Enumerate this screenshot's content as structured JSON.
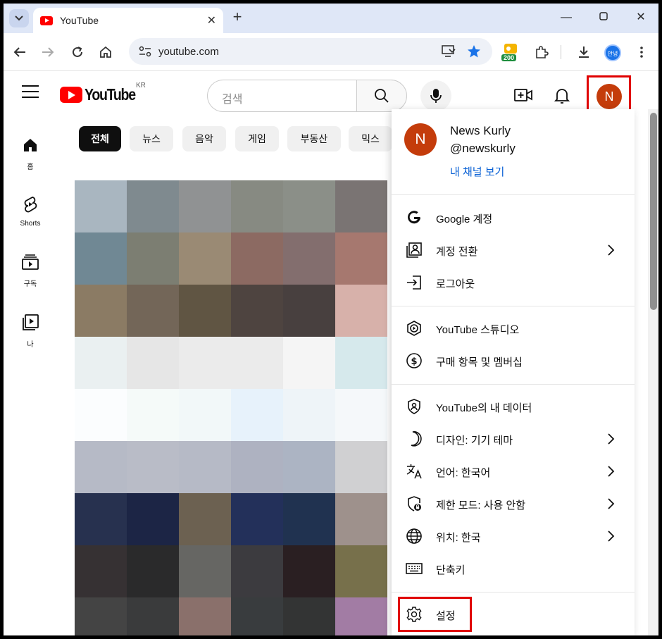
{
  "browser": {
    "tab_title": "YouTube",
    "tab_close": "✕",
    "new_tab": "+",
    "url": "youtube.com",
    "extension_badge": "200",
    "profile_chip_label": "안녕",
    "window_controls": {
      "minimize": "—",
      "maximize": "☐",
      "close": "✕"
    }
  },
  "masthead": {
    "logo_text": "YouTube",
    "region": "KR",
    "search_placeholder": "검색"
  },
  "user": {
    "avatar_letter": "N"
  },
  "guide": [
    {
      "label": "홈",
      "icon": "home-icon"
    },
    {
      "label": "Shorts",
      "icon": "shorts-icon"
    },
    {
      "label": "구독",
      "icon": "subscriptions-icon"
    },
    {
      "label": "나",
      "icon": "you-icon"
    }
  ],
  "chips": [
    "전체",
    "뉴스",
    "음악",
    "게임",
    "부동산",
    "믹스"
  ],
  "account_menu": {
    "name": "News Kurly",
    "handle": "@newskurly",
    "view_channel": "내 채널 보기",
    "groups": [
      [
        {
          "label": "Google 계정",
          "icon": "google-icon",
          "chevron": false
        },
        {
          "label": "계정 전환",
          "icon": "switch-account-icon",
          "chevron": true
        },
        {
          "label": "로그아웃",
          "icon": "sign-out-icon",
          "chevron": false
        }
      ],
      [
        {
          "label": "YouTube 스튜디오",
          "icon": "studio-icon",
          "chevron": false
        },
        {
          "label": "구매 항목 및 멤버십",
          "icon": "purchases-icon",
          "chevron": false
        }
      ],
      [
        {
          "label": "YouTube의 내 데이터",
          "icon": "your-data-icon",
          "chevron": false
        },
        {
          "label": "디자인: 기기 테마",
          "icon": "theme-icon",
          "chevron": true
        },
        {
          "label": "언어: 한국어",
          "icon": "language-icon",
          "chevron": true
        },
        {
          "label": "제한 모드: 사용 안함",
          "icon": "restricted-mode-icon",
          "chevron": true
        },
        {
          "label": "위치: 한국",
          "icon": "location-icon",
          "chevron": true
        },
        {
          "label": "단축키",
          "icon": "keyboard-icon",
          "chevron": false
        }
      ],
      [
        {
          "label": "설정",
          "icon": "settings-gear-icon",
          "chevron": false
        }
      ]
    ]
  },
  "colors": {
    "brand_red": "#ff0000",
    "avatar_bg": "#c43c0b",
    "link_blue": "#065fd4",
    "highlight_red": "#e00000"
  },
  "thumbnail_mosaic_colors": [
    [
      "#a9b6c0",
      "#7f8a8f",
      "#909293",
      "#878a82",
      "#8b8f88",
      "#7a7473"
    ],
    [
      "#708894",
      "#7c7e72",
      "#9a8a74",
      "#8c6a62",
      "#836e6e",
      "#a6786f"
    ],
    [
      "#8b7b64",
      "#736658",
      "#605543",
      "#4e4440",
      "#48403f",
      "#d7b1aa"
    ],
    [
      "#eaf0f1",
      "#e6e6e6",
      "#ebebeb",
      "#ebebeb",
      "#f5f5f5",
      "#d6e9ec"
    ],
    [
      "#fbfdfe",
      "#f5faf9",
      "#f2f8f9",
      "#e7f2fb",
      "#eef4f8",
      "#f5f8fa"
    ],
    [
      "#b6bac6",
      "#b9bcc7",
      "#b6bac6",
      "#aeb2c1",
      "#acb4c3",
      "#d0d0d2"
    ],
    [
      "#27314f",
      "#1c2545",
      "#6c6151",
      "#23305a",
      "#203250",
      "#9e918c"
    ],
    [
      "#363133",
      "#2a2a2b",
      "#666663",
      "#3c3b3f",
      "#2a1f22",
      "#77704b"
    ],
    [
      "#444444",
      "#3a3b3c",
      "#8a706b",
      "#393c3e",
      "#333434",
      "#a27ca4"
    ]
  ]
}
